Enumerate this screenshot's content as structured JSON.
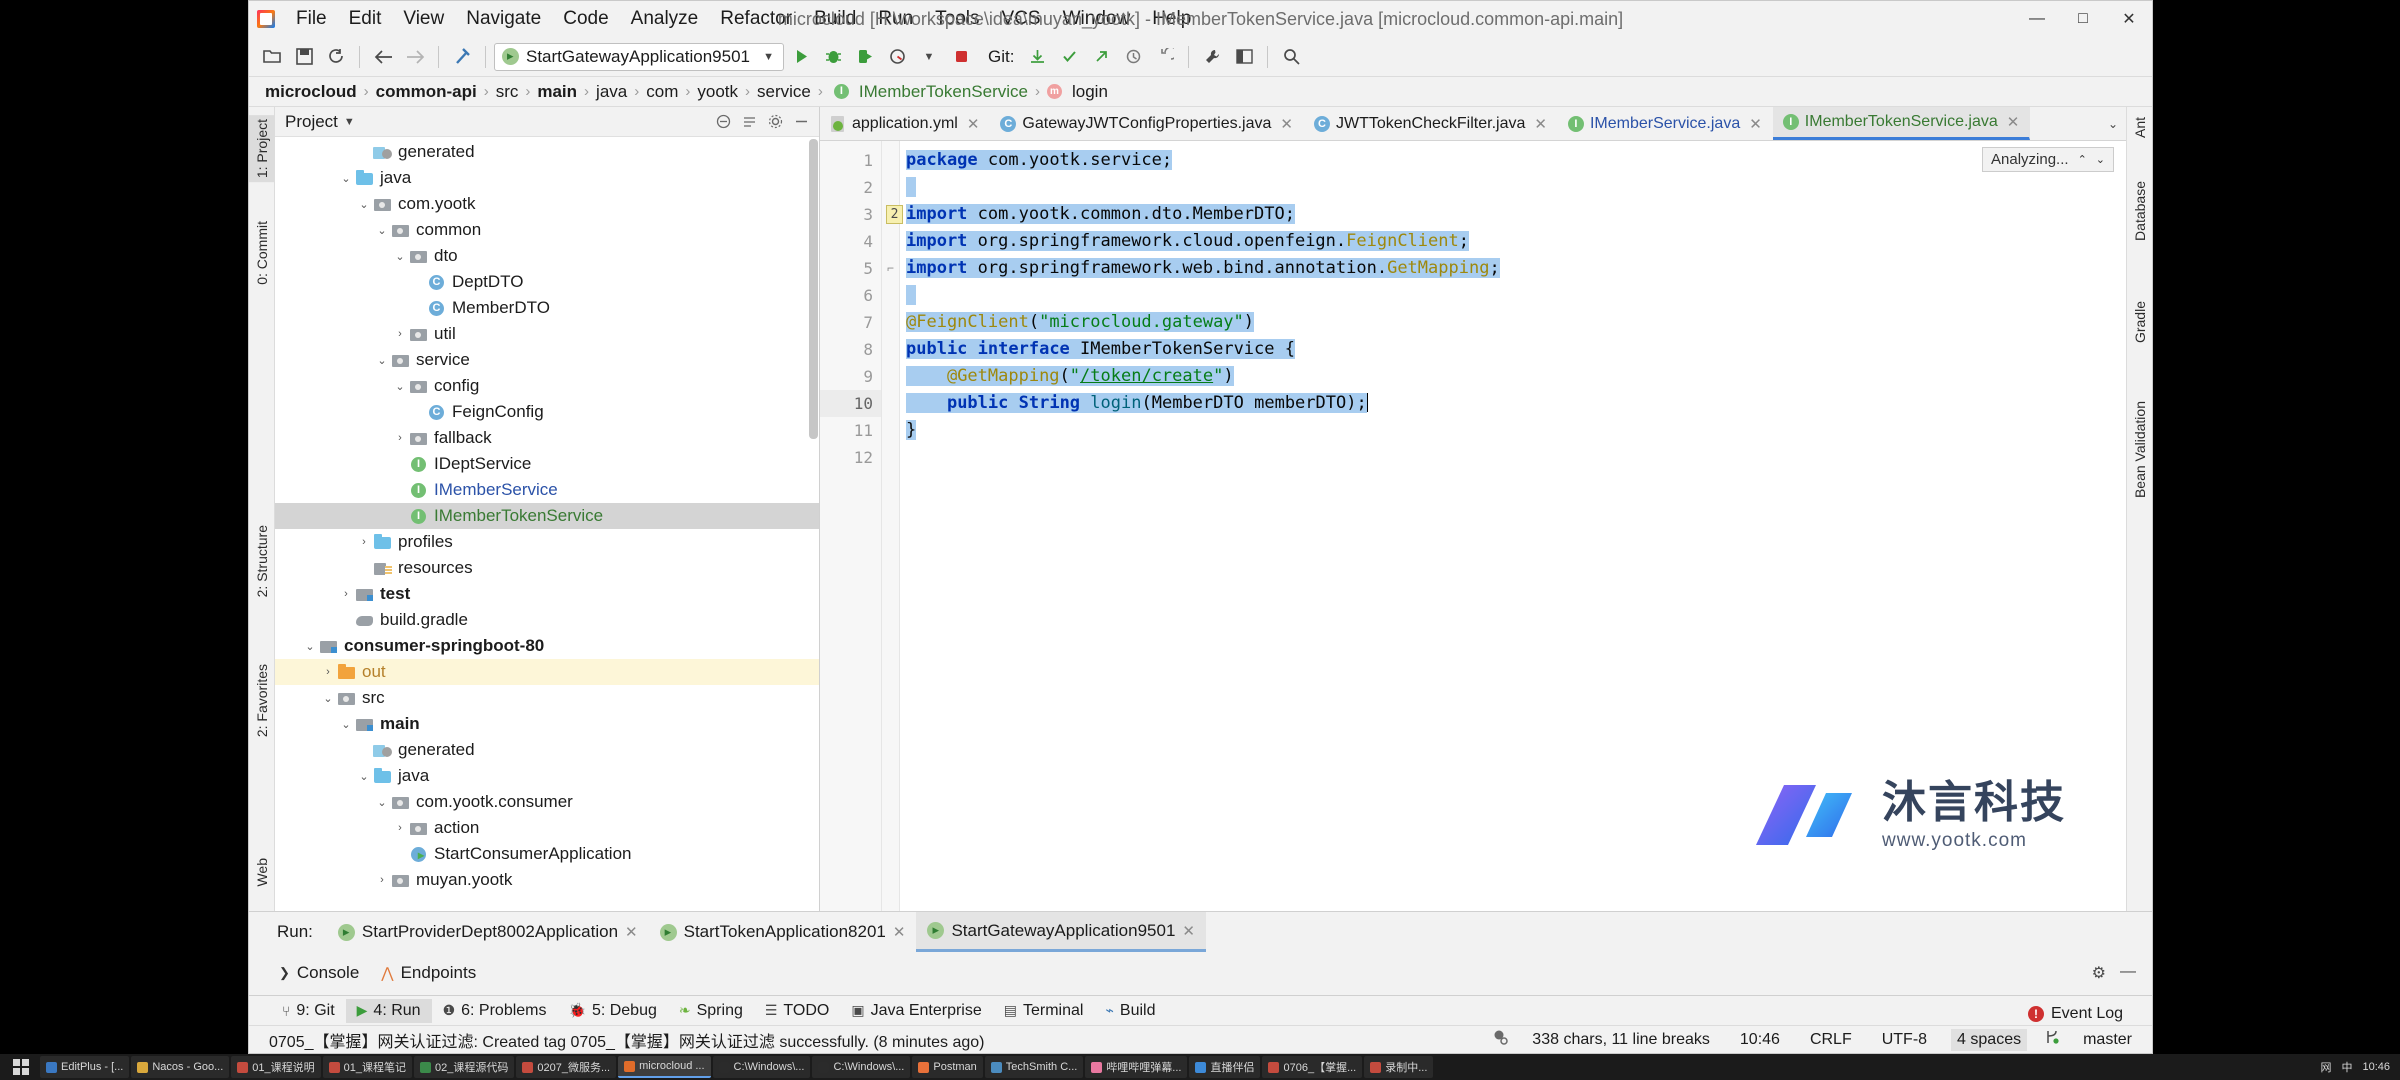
{
  "window": {
    "title": "microcloud [H:\\workspace\\idea\\muyan_yootk] - IMemberTokenService.java [microcloud.common-api.main]",
    "minimize": "—",
    "maximize": "□",
    "close": "✕"
  },
  "menu": [
    "File",
    "Edit",
    "View",
    "Navigate",
    "Code",
    "Analyze",
    "Refactor",
    "Build",
    "Run",
    "Tools",
    "VCS",
    "Window",
    "Help"
  ],
  "toolbar": {
    "open_icon": "folder-open-icon",
    "save_icon": "save-icon",
    "sync_icon": "sync-icon",
    "back_icon": "back-arrow-icon",
    "forward_icon": "forward-arrow-icon",
    "build_icon": "hammer-build-icon",
    "run_config": "StartGatewayApplication9501",
    "run_config_caret": "▼",
    "run_icon": "run-icon",
    "debug_icon": "debug-icon",
    "run_coverage_icon": "run-with-coverage-icon",
    "profile_icon": "profiler-icon",
    "profile_caret": "▼",
    "stop_icon": "stop-icon",
    "git_label": "Git:",
    "update_icon": "update-project-icon",
    "commit_icon": "commit-icon",
    "push_icon": "push-icon",
    "history_icon": "history-icon",
    "rollback_icon": "rollback-icon",
    "wrench_icon": "settings-wrench-icon",
    "layout_icon": "layout-icon",
    "search_icon": "search-everywhere-icon"
  },
  "breadcrumb": [
    {
      "label": "microcloud",
      "bold": true
    },
    {
      "label": "common-api",
      "bold": true
    },
    {
      "label": "src",
      "bold": false
    },
    {
      "label": "main",
      "bold": true
    },
    {
      "label": "java",
      "bold": false
    },
    {
      "label": "com",
      "bold": false
    },
    {
      "label": "yootk",
      "bold": false
    },
    {
      "label": "service",
      "bold": false
    },
    {
      "label": "IMemberTokenService",
      "bold": false,
      "icon": "interface-icon",
      "color": "green"
    },
    {
      "label": "login",
      "bold": false,
      "icon": "method-icon",
      "color": "plain"
    }
  ],
  "left_strip": [
    {
      "label": "1: Project",
      "selected": true
    },
    {
      "label": "0: Commit",
      "selected": false
    },
    {
      "label": "2: Structure",
      "selected": false
    },
    {
      "label": "2: Favorites",
      "selected": false
    },
    {
      "label": "Web",
      "selected": false
    }
  ],
  "right_strip": [
    {
      "label": "Ant"
    },
    {
      "label": "Database"
    },
    {
      "label": "Gradle"
    },
    {
      "label": "Bean Validation"
    }
  ],
  "project_panel": {
    "title": "Project",
    "caret": "▼",
    "tools": [
      "collapse-icon",
      "expand-icon",
      "settings-icon",
      "hide-icon"
    ],
    "tree": [
      {
        "depth": 4,
        "arrow": "",
        "icon": "genfolder",
        "label": "generated",
        "color": "",
        "bold": false
      },
      {
        "depth": 3,
        "arrow": "⌄",
        "icon": "folder",
        "label": "java",
        "color": "",
        "bold": false
      },
      {
        "depth": 4,
        "arrow": "⌄",
        "icon": "pkg",
        "label": "com.yootk",
        "color": "",
        "bold": false
      },
      {
        "depth": 5,
        "arrow": "⌄",
        "icon": "pkg",
        "label": "common",
        "color": "",
        "bold": false
      },
      {
        "depth": 6,
        "arrow": "⌄",
        "icon": "pkg",
        "label": "dto",
        "color": "",
        "bold": false
      },
      {
        "depth": 7,
        "arrow": "",
        "icon": "cls",
        "label": "DeptDTO",
        "color": "",
        "bold": false
      },
      {
        "depth": 7,
        "arrow": "",
        "icon": "cls",
        "label": "MemberDTO",
        "color": "",
        "bold": false
      },
      {
        "depth": 6,
        "arrow": "›",
        "icon": "pkg",
        "label": "util",
        "color": "",
        "bold": false
      },
      {
        "depth": 5,
        "arrow": "⌄",
        "icon": "pkg",
        "label": "service",
        "color": "",
        "bold": false
      },
      {
        "depth": 6,
        "arrow": "⌄",
        "icon": "pkg",
        "label": "config",
        "color": "",
        "bold": false
      },
      {
        "depth": 7,
        "arrow": "",
        "icon": "cls",
        "label": "FeignConfig",
        "color": "",
        "bold": false
      },
      {
        "depth": 6,
        "arrow": "›",
        "icon": "pkg",
        "label": "fallback",
        "color": "",
        "bold": false
      },
      {
        "depth": 6,
        "arrow": "",
        "icon": "intf",
        "label": "IDeptService",
        "color": "",
        "bold": false
      },
      {
        "depth": 6,
        "arrow": "",
        "icon": "intf",
        "label": "IMemberService",
        "color": "blue",
        "bold": false
      },
      {
        "depth": 6,
        "arrow": "",
        "icon": "intf",
        "label": "IMemberTokenService",
        "color": "green",
        "bold": false,
        "selected": true
      },
      {
        "depth": 4,
        "arrow": "›",
        "icon": "folder",
        "label": "profiles",
        "color": "",
        "bold": false
      },
      {
        "depth": 4,
        "arrow": "",
        "icon": "resfolder",
        "label": "resources",
        "color": "",
        "bold": false
      },
      {
        "depth": 3,
        "arrow": "›",
        "icon": "module",
        "label": "test",
        "color": "",
        "bold": true
      },
      {
        "depth": 3,
        "arrow": "",
        "icon": "gradle",
        "label": "build.gradle",
        "color": "",
        "bold": false
      },
      {
        "depth": 1,
        "arrow": "⌄",
        "icon": "module",
        "label": "consumer-springboot-80",
        "color": "",
        "bold": true
      },
      {
        "depth": 2,
        "arrow": "›",
        "icon": "outfolder",
        "label": "out",
        "color": "orange",
        "bold": false,
        "highlight": true
      },
      {
        "depth": 2,
        "arrow": "⌄",
        "icon": "pkg",
        "label": "src",
        "color": "",
        "bold": false
      },
      {
        "depth": 3,
        "arrow": "⌄",
        "icon": "module",
        "label": "main",
        "color": "",
        "bold": true
      },
      {
        "depth": 4,
        "arrow": "",
        "icon": "genfolder",
        "label": "generated",
        "color": "",
        "bold": false
      },
      {
        "depth": 4,
        "arrow": "⌄",
        "icon": "folder",
        "label": "java",
        "color": "",
        "bold": false
      },
      {
        "depth": 5,
        "arrow": "⌄",
        "icon": "pkg",
        "label": "com.yootk.consumer",
        "color": "",
        "bold": false
      },
      {
        "depth": 6,
        "arrow": "›",
        "icon": "pkg",
        "label": "action",
        "color": "",
        "bold": false
      },
      {
        "depth": 6,
        "arrow": "",
        "icon": "boot",
        "label": "StartConsumerApplication",
        "color": "",
        "bold": false
      },
      {
        "depth": 5,
        "arrow": "›",
        "icon": "pkg",
        "label": "muyan.yootk",
        "color": "",
        "bold": false
      }
    ]
  },
  "editor_tabs": [
    {
      "label": "application.yml",
      "icon": "yml",
      "color": "",
      "close": "✕",
      "active": false
    },
    {
      "label": "GatewayJWTConfigProperties.java",
      "icon": "cls",
      "color": "",
      "close": "✕",
      "active": false
    },
    {
      "label": "JWTTokenCheckFilter.java",
      "icon": "cls",
      "color": "",
      "close": "✕",
      "active": false
    },
    {
      "label": "IMemberService.java",
      "icon": "intf",
      "color": "blue",
      "close": "✕",
      "active": false
    },
    {
      "label": "IMemberTokenService.java",
      "icon": "intf",
      "color": "green",
      "close": "✕",
      "active": true
    }
  ],
  "editor_tabs_more": "⌄",
  "editor": {
    "analyzing_label": "Analyzing...",
    "analyzing_caret_up": "⌃",
    "analyzing_caret_down": "⌄",
    "line_numbers": [
      "1",
      "2",
      "3",
      "4",
      "5",
      "6",
      "7",
      "8",
      "9",
      "10",
      "11",
      "12"
    ],
    "import_badge": "2",
    "current_line": 10,
    "code_lines": [
      {
        "n": 1,
        "text": "package com.yootk.service;",
        "selected": true
      },
      {
        "n": 2,
        "text": "",
        "selected": true
      },
      {
        "n": 3,
        "text": "import com.yootk.common.dto.MemberDTO;",
        "selected": true
      },
      {
        "n": 4,
        "text": "import org.springframework.cloud.openfeign.FeignClient;",
        "selected": true
      },
      {
        "n": 5,
        "text": "import org.springframework.web.bind.annotation.GetMapping;",
        "selected": true
      },
      {
        "n": 6,
        "text": "",
        "selected": true
      },
      {
        "n": 7,
        "text": "@FeignClient(\"microcloud.gateway\")",
        "selected": true
      },
      {
        "n": 8,
        "text": "public interface IMemberTokenService {",
        "selected": true
      },
      {
        "n": 9,
        "text": "    @GetMapping(\"/token/create\")",
        "selected": true
      },
      {
        "n": 10,
        "text": "    public String login(MemberDTO memberDTO);",
        "selected": true
      },
      {
        "n": 11,
        "text": "}",
        "selected": true
      },
      {
        "n": 12,
        "text": "",
        "selected": false
      }
    ]
  },
  "watermark": {
    "title": "沐言科技",
    "url": "www.yootk.com"
  },
  "run_panel": {
    "label": "Run:",
    "tabs": [
      {
        "label": "StartProviderDept8002Application",
        "close": "✕",
        "active": false
      },
      {
        "label": "StartTokenApplication8201",
        "close": "✕",
        "active": false
      },
      {
        "label": "StartGatewayApplication9501",
        "close": "✕",
        "active": true
      }
    ],
    "sub_tabs": [
      {
        "label": "Console",
        "icon": "console-icon"
      },
      {
        "label": "Endpoints",
        "icon": "endpoints-icon"
      }
    ],
    "gear": "⚙",
    "minimize": "—"
  },
  "bottom_tabs": [
    {
      "label": "9: Git",
      "icon": "git-icon",
      "selected": false
    },
    {
      "label": "4: Run",
      "icon": "run-icon",
      "selected": true
    },
    {
      "label": "6: Problems",
      "icon": "problems-icon",
      "selected": false
    },
    {
      "label": "5: Debug",
      "icon": "debug-icon",
      "selected": false
    },
    {
      "label": "Spring",
      "icon": "spring-leaf-icon",
      "selected": false
    },
    {
      "label": "TODO",
      "icon": "todo-icon",
      "selected": false
    },
    {
      "label": "Java Enterprise",
      "icon": "java-enterprise-icon",
      "selected": false
    },
    {
      "label": "Terminal",
      "icon": "terminal-icon",
      "selected": false
    },
    {
      "label": "Build",
      "icon": "build-icon",
      "selected": false
    }
  ],
  "status": {
    "message": "0705_【掌握】网关认证过滤: Created tag 0705_【掌握】网关认证过滤 successfully. (8 minutes ago)",
    "chars": "338 chars, 11 line breaks",
    "caret_pos": "10:46",
    "line_sep": "CRLF",
    "encoding": "UTF-8",
    "indent": "4 spaces",
    "branch": "master",
    "event_log": "Event Log",
    "event_log_badge": "!",
    "inspection_icon": "inspection-icon",
    "branch_icon": "git-branch-icon"
  },
  "taskbar": {
    "start_icon": "windows-start-icon",
    "items": [
      {
        "label": "EditPlus - [...",
        "color": "#3a78c2",
        "active": false
      },
      {
        "label": "Nacos - Goo...",
        "color": "#d9a83c",
        "active": false
      },
      {
        "label": "01_课程说明",
        "color": "#c44b3e",
        "active": false
      },
      {
        "label": "01_课程笔记",
        "color": "#c44b3e",
        "active": false
      },
      {
        "label": "02_课程源代码",
        "color": "#3b8a4a",
        "active": false
      },
      {
        "label": "0207_微服务...",
        "color": "#c44b3e",
        "active": false
      },
      {
        "label": "microcloud ...",
        "color": "#e06c2a",
        "active": true
      },
      {
        "label": "C:\\Windows\\...",
        "color": "#2b2b2b",
        "active": false
      },
      {
        "label": "C:\\Windows\\...",
        "color": "#2b2b2b",
        "active": false
      },
      {
        "label": "Postman",
        "color": "#e8713a",
        "active": false
      },
      {
        "label": "TechSmith C...",
        "color": "#4b8bbe",
        "active": false
      },
      {
        "label": "哔哩哔哩弹幕...",
        "color": "#e878a0",
        "active": false
      },
      {
        "label": "直播伴侣",
        "color": "#3d8ad8",
        "active": false
      },
      {
        "label": "0706_【掌握...",
        "color": "#c44b3e",
        "active": false
      },
      {
        "label": "录制中...",
        "color": "#c44b3e",
        "active": false
      }
    ],
    "tray": [
      "网",
      "中",
      "10:46"
    ]
  }
}
